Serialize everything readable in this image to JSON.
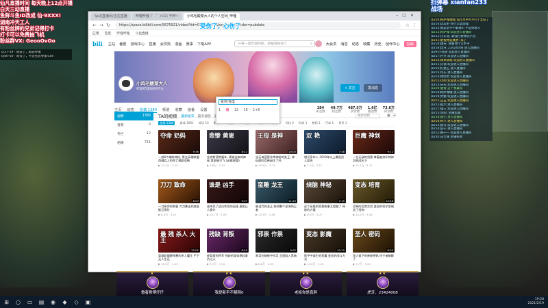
{
  "overlay_left": {
    "lines": [
      "仙凡直播时间 每天晚上12点开播",
      "白天三动直播",
      "鱼鲜斗鱼ID改成 仙·9XXX!",
      "湖南冲天工人",
      "有粉丝牌的兄弟记得打卡",
      "打卡可以免费抽飞机",
      "粉丝群VX: GeooOvOo"
    ],
    "small": [
      "q·27-19 · 同去了，再去参加",
      "tyler·60 · 同去了，不过先去参加·Lee"
    ]
  },
  "browser": {
    "tabs": [
      "Sp2J直播间/正在直播",
      "哔哩哔哩 (゜-゜)つロ 干杯~",
      "小鸡毛酸菜大人的个人空间_哔哩"
    ],
    "url": "https://space.bilibili.com/5675921/video?tid=0&page=1&keyword=&order=pubdate",
    "bookmarks": [
      "应用",
      "百度",
      "哔哩哔哩",
      "斗鱼直播"
    ],
    "site_nav": [
      "主站",
      "番剧",
      "游戏中心",
      "直播",
      "会员购",
      "漫画",
      "赛事",
      "下载APP"
    ],
    "search_placeholder": "只有一首年轻的歌，想拍就拍好了",
    "header_right": [
      "大会员",
      "消息",
      "动态",
      "收藏",
      "历史",
      "创作中心",
      "投稿"
    ],
    "banner": {
      "name": "小鸡毛酸菜大人",
      "subtitle": "哔哩哔哩知名UP主",
      "follow": "+ 关注",
      "message": "发消息"
    },
    "popup": {
      "input": "投币/充电",
      "options": [
        "1",
        "赠",
        "12",
        "16",
        "1+6"
      ]
    },
    "tabs_nav": [
      "主页",
      "动态",
      "投稿 1380",
      "频道",
      "收藏",
      "追番",
      "设置"
    ],
    "stats": [
      {
        "label": "关注数",
        "value": "184"
      },
      {
        "label": "粉丝数",
        "value": "49.7万"
      },
      {
        "label": "获赞数",
        "value": "487.5万"
      },
      {
        "label": "播放数",
        "value": "1.6亿"
      },
      {
        "label": "阅读数",
        "value": "73.6万"
      }
    ],
    "sidebar": [
      {
        "label": "视频",
        "count": "1380"
      },
      {
        "label": "音频",
        "count": "0"
      },
      {
        "label": "专栏",
        "count": "12"
      },
      {
        "label": "相簿",
        "count": "711"
      }
    ],
    "content_title": "TA的视频",
    "sort": [
      "最新发布",
      "最多播放",
      "最多收藏"
    ],
    "search_in": "搜索视频",
    "filters": [
      "全部 1380",
      "游戏 1061",
      "知识 15",
      "影视 13",
      "生活 13",
      "动画 12",
      "音乐 2",
      "娱乐 9",
      "科技 2",
      "时尚 1",
      "数码 1",
      "汽车 1",
      "资讯 1"
    ],
    "videos": [
      {
        "thumb": "夺命 奶妈",
        "caption": "一部8个辅助神档, 第五英雄联盟首辅女人的死亡辅助攻略",
        "views": "12.3万",
        "date": "3-15",
        "dur": "9:46",
        "bg1": "#5a2a18",
        "bg2": "#1a0a08"
      },
      {
        "thumb": "悲惨 黄崽",
        "caption": "金克斯悲惨童年, 黄崽出来的神秘 我家被打飞 (英雄联盟)",
        "views": "9.8万",
        "date": "3-14",
        "dur": "8:22",
        "bg1": "#3c3a46",
        "bg2": "#121016"
      },
      {
        "thumb": "王母 是神",
        "caption": "宝石海蓝是非常神秘的女王, 神仙般的女神诞生了吗",
        "views": "15.6万",
        "date": "3-13",
        "dur": "10:05",
        "bg1": "#9a6a6a",
        "bg2": "#3e2020"
      },
      {
        "thumb": "双 艳",
        "caption": "相识多年人 2019年以上最强双人组合",
        "views": "7.2万",
        "date": "3-12",
        "dur": "7:48",
        "bg1": "#2e4a6a",
        "bg2": "#0c1a2a"
      },
      {
        "thumb": "巨魔 神剑",
        "caption": "一位无敌的剑客 拿着被封印的神剑挑战天下",
        "views": "11.1万",
        "date": "3-11",
        "dur": "9:12",
        "bg1": "#6a2a1a",
        "bg2": "#1a0606"
      },
      {
        "thumb": "刀刀 致命",
        "caption": "一刀致命的刺客 刀刀暴击到底谁能扛得住",
        "views": "8.4万",
        "date": "3-10",
        "dur": "8:03",
        "bg1": "#a45a1a",
        "bg2": "#2a1204"
      },
      {
        "thumb": "谁是 凶手",
        "caption": "谁杀死了这位传奇的英雄 真相让人意外",
        "views": "10.7万",
        "date": "3-09",
        "dur": "9:37",
        "bg1": "#3a1a1a",
        "bg2": "#100404"
      },
      {
        "thumb": "蛮雕 龙王",
        "caption": "被诅咒的龙王 统领整个深海的王者",
        "views": "13.9万",
        "date": "3-08",
        "dur": "11:20",
        "bg1": "#3a5a6a",
        "bg2": "#0a1c24"
      },
      {
        "thumb": "烧脑 神秘",
        "caption": "这个英雄的背景故事太烧脑了 神秘的力量",
        "views": "6.9万",
        "date": "3-07",
        "dur": "7:15",
        "bg1": "#5a4a3a",
        "bg2": "#1a1208"
      },
      {
        "thumb": "变态 培育",
        "caption": "恐怖的培育实验 变态的科学家制造了怪物",
        "views": "14.2万",
        "date": "3-06",
        "dur": "10:48",
        "bg1": "#6a5a2a",
        "bg2": "#221a06"
      },
      {
        "thumb": "最 残 杀人 大王",
        "caption": "英雄联盟最残暴的杀人魔王 手下无人生还",
        "views": "16.5万",
        "date": "3-05",
        "dur": "12:01",
        "bg1": "#8a1a1a",
        "bg2": "#2a0404"
      },
      {
        "thumb": "残缺 背叛",
        "caption": "被背叛的将军 残缺的身体燃起复仇之火",
        "views": "9.3万",
        "date": "3-04",
        "dur": "8:55",
        "bg1": "#6a2a6a",
        "bg2": "#1a061a"
      },
      {
        "thumb": "邪祟 作祟",
        "caption": "邪祟在暗夜中作祟 王国陷入黑暗",
        "views": "8.8万",
        "date": "3-03",
        "dur": "9:02",
        "bg1": "#2a2a2a",
        "bg2": "#080808"
      },
      {
        "thumb": "变态 影魔",
        "caption": "影子中诞生的恶魔 变态的战斗方式",
        "views": "12.0万",
        "date": "3-02",
        "dur": "10:10",
        "bg1": "#4a3a2a",
        "bg2": "#140e06"
      },
      {
        "thumb": "圣人 密码",
        "caption": "圣人留下的神秘密码 终于被破解了",
        "views": "7.7万",
        "date": "3-01",
        "dur": "8:30",
        "bg1": "#6a4a1a",
        "bg2": "#1c1004"
      }
    ]
  },
  "overlay_mid": "受伤了，心伤了",
  "overlay_right": {
    "top": [
      "扫弹幕 xianfan233",
      "战场"
    ],
    "chat": [
      "[LV20]阿萨嘎嘎嘎 仙凡水平咋不行? 太狂了",
      "[LV16]玩玩吧 你什么意思嘎",
      "[LV14]我是新手不解释0: 不是你本人",
      "[LV15]阿萨嘎 欢迎进入直播间",
      "[LV12]小东北: 最强打野你玩不过",
      "[LV21]老板你是真胖: 来了",
      "[LV10]唐宋: 我看你什么水平",
      "[LV18]虎牙_23424008 进入直播间",
      "[LV9]小怪兽 欢迎进入直播间",
      "[LV17]丹丹 欢迎进入直播间",
      "[LV13]呆呆萌萌 欢迎进入直播间",
      "[LV11]火锅 欢迎进入直播间",
      "[LV16]打野王 进入直播间",
      "[LV15]可乐 进入直播间",
      "[LV14]哈哈哈 欢迎进入直播间",
      "[LV12]小明 欢迎进入直播间",
      "[LV13]天天 欢迎进入直播间",
      "[LV20]香香 这个我喜欢",
      "[LV10]阿萨嘎嘎 进入直播间",
      "[LV19]大斌 欢迎进入直播间",
      "[LV11]王五 欢迎进入直播间",
      "[LV12]赵六 进入直播间",
      "[LV17]张三 欢迎进入直播间",
      "[LV15]李四: 主播加油",
      "[LV18]钱七 进入直播间",
      "[LV16]孙八 进入直播间",
      "[LV13]周九 欢迎进入直播间",
      "[LV14]吴十 进入直播间",
      "[LV12]郑十一 欢迎进入直播间",
      "[LV20]王大锤 主播好帅"
    ]
  },
  "hud": [
    {
      "name": "傲者骨博仔仔",
      "stars": "★"
    },
    {
      "name": "我是新手不解释0",
      "stars": "★★"
    },
    {
      "name": "老板你是真胖",
      "stars": "★★"
    },
    {
      "name": "虎牙、23424008",
      "stars": "★★"
    }
  ],
  "taskbar": {
    "time": "19:58",
    "date": "2021/2/19"
  }
}
